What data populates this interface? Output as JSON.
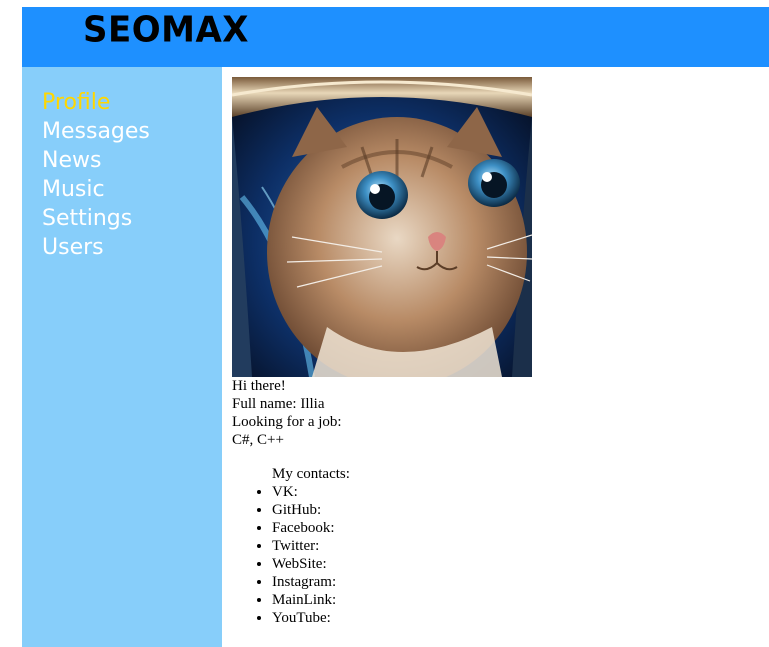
{
  "header": {
    "logo_text": "SEOMAX"
  },
  "sidebar": {
    "items": [
      {
        "label": "Profile",
        "active": true
      },
      {
        "label": "Messages",
        "active": false
      },
      {
        "label": "News",
        "active": false
      },
      {
        "label": "Music",
        "active": false
      },
      {
        "label": "Settings",
        "active": false
      },
      {
        "label": "Users",
        "active": false
      }
    ],
    "active_color": "#ffd700",
    "item_color": "#ffffff",
    "background": "#87cefa"
  },
  "header_background": "#1e90ff",
  "profile": {
    "avatar_icon": "astronaut-cat-photo",
    "greeting": "Hi there!",
    "full_name": "Full name: Illia",
    "job_status": "Looking for a job:",
    "job_description": "C#, C++",
    "contacts_title": "My contacts:",
    "contacts": [
      {
        "label": "VK:"
      },
      {
        "label": "GitHub:"
      },
      {
        "label": "Facebook:"
      },
      {
        "label": "Twitter:"
      },
      {
        "label": "WebSite:"
      },
      {
        "label": "Instagram:"
      },
      {
        "label": "MainLink:"
      },
      {
        "label": "YouTube:"
      }
    ]
  }
}
